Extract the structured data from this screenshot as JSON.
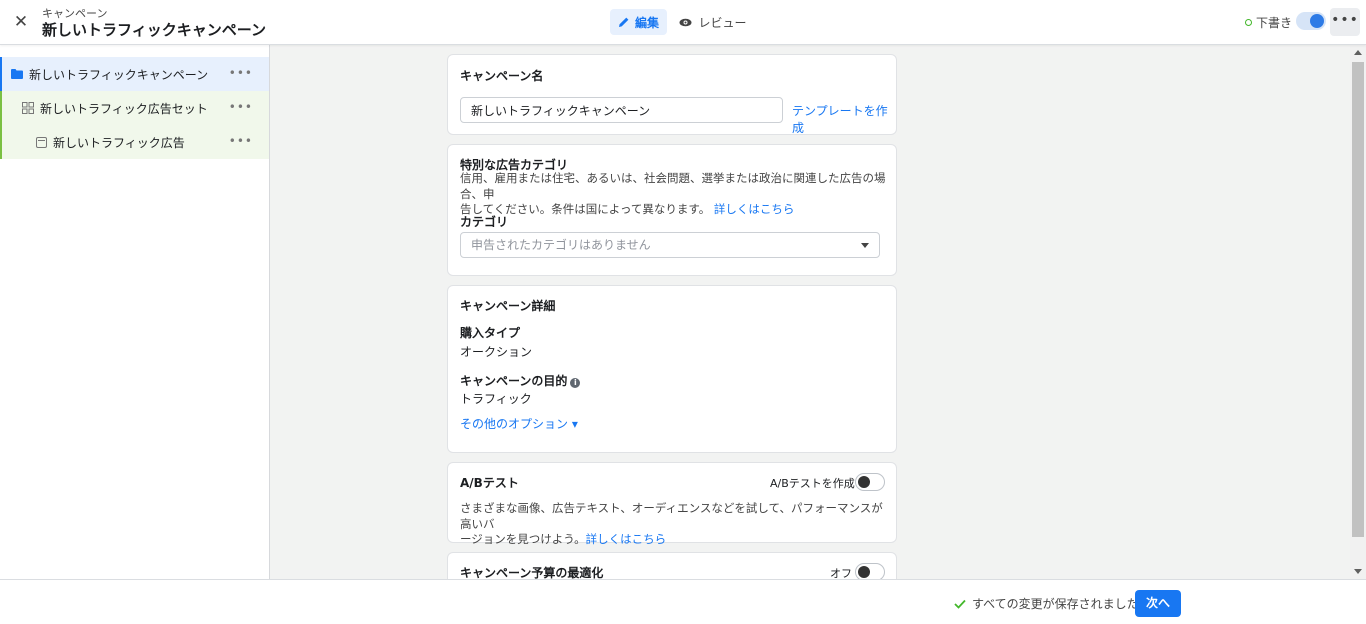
{
  "header": {
    "subtitle": "キャンペーン",
    "title": "新しいトラフィックキャンペーン",
    "tab_edit": "編集",
    "tab_review": "レビュー",
    "status": "下書き",
    "more": "•••"
  },
  "sidebar": {
    "items": [
      {
        "label": "新しいトラフィックキャンペーン",
        "dots": "•••"
      },
      {
        "label": "新しいトラフィック広告セット",
        "dots": "•••"
      },
      {
        "label": "新しいトラフィック広告",
        "dots": "•••"
      }
    ]
  },
  "campaign_name": {
    "title": "キャンペーン名",
    "value": "新しいトラフィックキャンペーン",
    "template_link": "テンプレートを作成"
  },
  "special_category": {
    "title": "特別な広告カテゴリ",
    "description_line1": "信用、雇用または住宅、あるいは、社会問題、選挙または政治に関連した広告の場合、申",
    "description_line2": "告してください。条件は国によって異なります。",
    "learn_more": "詳しくはこちら",
    "category_label": "カテゴリ",
    "category_placeholder": "申告されたカテゴリはありません"
  },
  "campaign_details": {
    "title": "キャンペーン詳細",
    "buying_type_label": "購入タイプ",
    "buying_type_value": "オークション",
    "objective_label": "キャンペーンの目的",
    "objective_value": "トラフィック",
    "more_options": "その他のオプション ▾"
  },
  "ab_test": {
    "title": "A/Bテスト",
    "toggle_label": "A/Bテストを作成",
    "description_line1": "さまざまな画像、広告テキスト、オーディエンスなどを試して、パフォーマンスが高いバ",
    "description_line2": "ージョンを見つけよう。",
    "learn_more": "詳しくはこちら"
  },
  "budget_optimization": {
    "title": "キャンペーン予算の最適化",
    "toggle_label": "オフ"
  },
  "footer": {
    "saved_text": "すべての変更が保存されました",
    "next_button": "次へ"
  },
  "colors": {
    "accent": "#1877f2",
    "adset_green": "#7bc043",
    "draft_green": "#42b72a"
  }
}
